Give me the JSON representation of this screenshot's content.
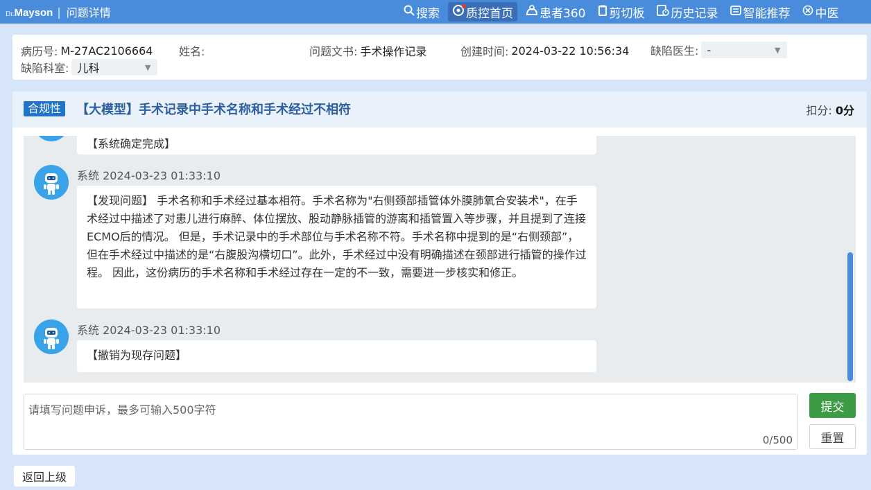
{
  "app": {
    "brand_prefix": "Dr.",
    "brand_name": "Mayson",
    "brand_sep": "|",
    "page_title": "问题详情"
  },
  "nav": [
    {
      "label": "搜索",
      "icon": "search-icon"
    },
    {
      "label": "质控首页",
      "icon": "qc-home-icon"
    },
    {
      "label": "患者360",
      "icon": "patient-icon"
    },
    {
      "label": "剪切板",
      "icon": "clipboard-icon"
    },
    {
      "label": "历史记录",
      "icon": "history-icon"
    },
    {
      "label": "智能推荐",
      "icon": "recommend-icon"
    },
    {
      "label": "中医",
      "icon": "close-circle-icon"
    }
  ],
  "info": {
    "record_no_label": "病历号:",
    "record_no": "M-27AC2106664",
    "name_label": "姓名:",
    "name": "",
    "doc_label": "问题文书:",
    "doc": "手术操作记录",
    "created_label": "创建时间:",
    "created": "2024-03-22 10:56:34",
    "doctor_label": "缺陷医生:",
    "doctor": "-",
    "dept_label": "缺陷科室:",
    "dept": "儿科"
  },
  "issue": {
    "badge": "合规性",
    "title": "【大模型】手术记录中手术名称和手术经过不相符",
    "score_label": "扣分:",
    "score": "0分"
  },
  "messages": [
    {
      "text": "【系统确定完成】"
    },
    {
      "author": "系统",
      "time": "2024-03-23 01:33:10",
      "text": "【发现问题】 手术名称和手术经过基本相符。手术名称为\"右侧颈部插管体外膜肺氧合安装术\"，在手术经过中描述了对患儿进行麻醉、体位摆放、股动静脉插管的游离和插管置入等步骤，并且提到了连接ECMO后的情况。 但是，手术记录中的手术部位与手术名称不符。手术名称中提到的是“右侧颈部”，但在手术经过中描述的是“右腹股沟横切口”。此外，手术经过中没有明确描述在颈部进行插管的操作过程。 因此，这份病历的手术名称和手术经过存在一定的不一致，需要进一步核实和修正。"
    },
    {
      "author": "系统",
      "time": "2024-03-23 01:33:10",
      "text": "【撤销为现存问题】"
    }
  ],
  "input": {
    "placeholder": "请填写问题申诉，最多可输入500字符",
    "counter": "0/500",
    "submit": "提交",
    "reset": "重置"
  },
  "footer": {
    "back": "返回上级"
  },
  "colors": {
    "topbar": "#4a8cdc",
    "accent": "#1f73c8",
    "submit": "#3c9b45"
  }
}
